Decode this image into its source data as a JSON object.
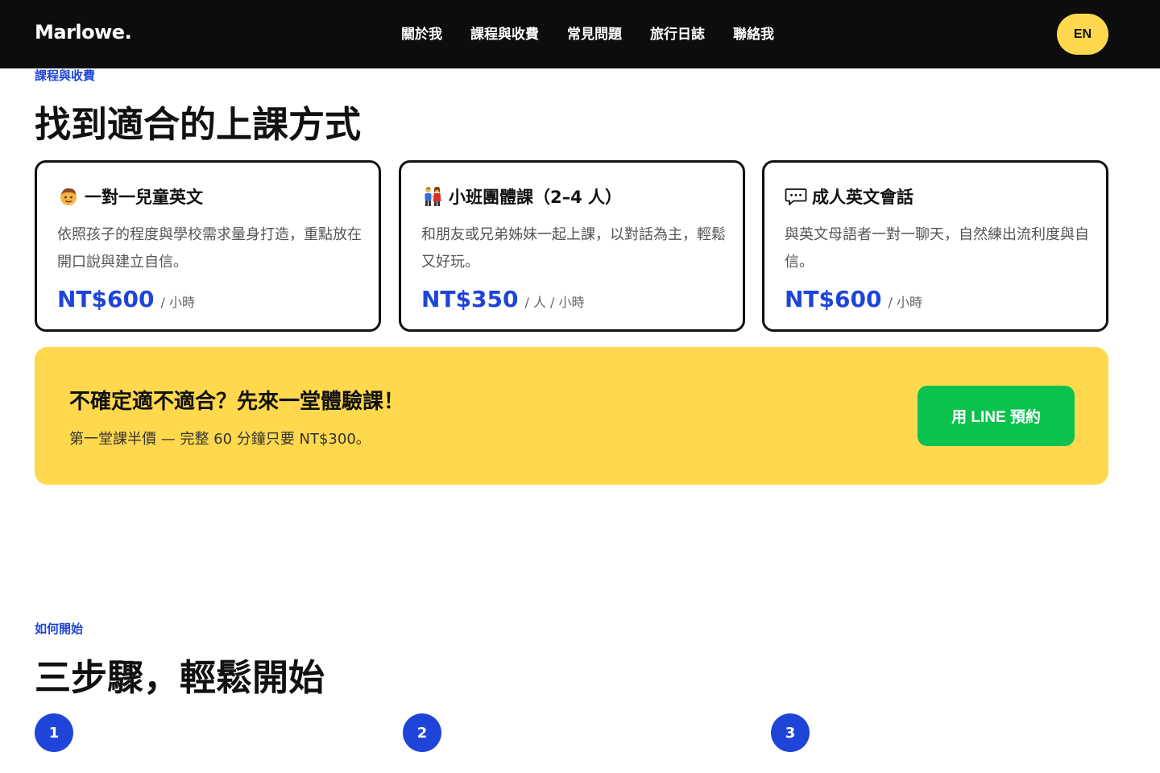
{
  "nav": {
    "brand": "Marlowe.",
    "links": [
      "關於我",
      "課程與收費",
      "常見問題",
      "旅行日誌",
      "聯絡我"
    ],
    "lang_button": "EN"
  },
  "pricing": {
    "eyebrow": "課程與收費",
    "title": "找到適合的上課方式",
    "cards": [
      {
        "icon": "child-face-icon",
        "title": "一對一兒童英文",
        "description": "依照孩子的程度與學校需求量身打造，重點放在開口說與建立自信。",
        "price": "NT$600",
        "unit": "/ 小時"
      },
      {
        "icon": "people-holding-hands-icon",
        "title": "小班團體課（2–4 人）",
        "description": "和朋友或兄弟姊妹一起上課，以對話為主，輕鬆又好玩。",
        "price": "NT$350",
        "unit": "/ 人 / 小時"
      },
      {
        "icon": "speech-bubble-icon",
        "title": "成人英文會話",
        "description": "與英文母語者一對一聊天，自然練出流利度與自信。",
        "price": "NT$600",
        "unit": "/ 小時"
      }
    ]
  },
  "cta": {
    "title": "不確定適不適合？先來一堂體驗課！",
    "subtitle": "第一堂課半價 — 完整 60 分鐘只要 NT$300。",
    "button": "用 LINE 預約",
    "bg_color": "#ffd84d",
    "button_color": "#0bc24e"
  },
  "steps": {
    "eyebrow": "如何開始",
    "title": "三步驟，輕鬆開始",
    "numbers": [
      "1",
      "2",
      "3"
    ]
  },
  "colors": {
    "accent": "#1f44d8",
    "nav_bg": "#0d0d0d",
    "lang_bg": "#ffd84d"
  }
}
